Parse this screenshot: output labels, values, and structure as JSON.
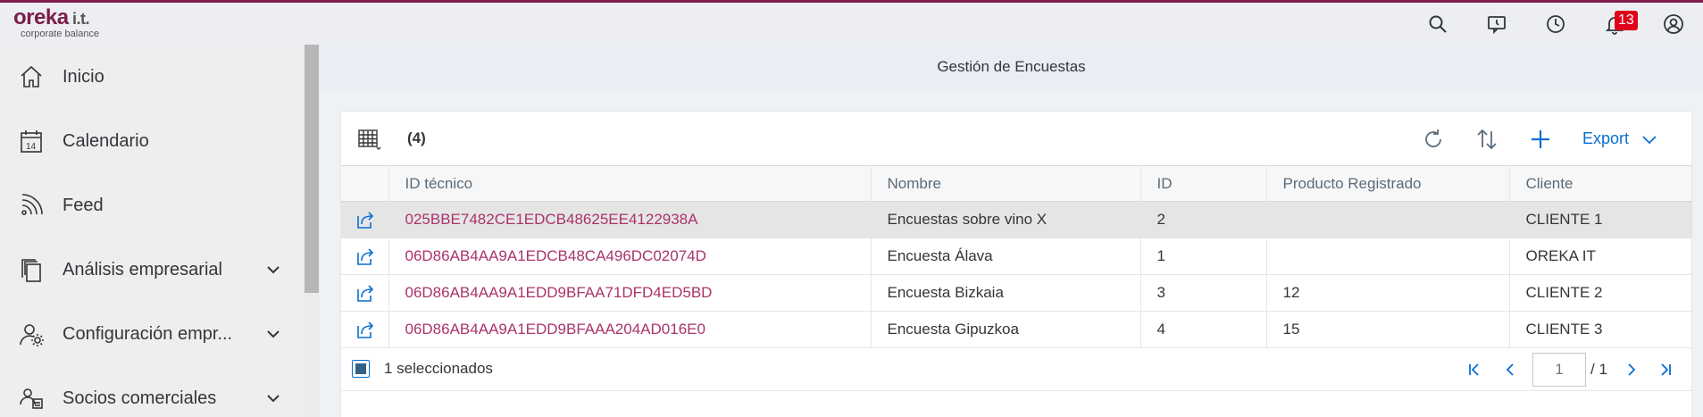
{
  "app": {
    "logo_main": "oreka",
    "logo_it": " i.t.",
    "logo_sub": "corporate balance",
    "notification_count": "13",
    "accent_color": "#7c1d4b"
  },
  "sidebar": {
    "items": [
      {
        "label": "Inicio",
        "icon": "home-icon",
        "expandable": false
      },
      {
        "label": "Calendario",
        "icon": "calendar-icon",
        "expandable": false
      },
      {
        "label": "Feed",
        "icon": "feed-icon",
        "expandable": false
      },
      {
        "label": "Análisis empresarial",
        "icon": "copy-icon",
        "expandable": true
      },
      {
        "label": "Configuración empr...",
        "icon": "settings-user-icon",
        "expandable": true
      },
      {
        "label": "Socios comerciales",
        "icon": "partners-icon",
        "expandable": true
      }
    ]
  },
  "page": {
    "title": "Gestión de Encuestas"
  },
  "toolbar": {
    "count": "(4)",
    "export_label": "Export"
  },
  "table": {
    "columns": [
      "ID técnico",
      "Nombre",
      "ID",
      "Producto Registrado",
      "Cliente"
    ],
    "rows": [
      {
        "tech_id": "025BBE7482CE1EDCB48625EE4122938A",
        "name": "Encuestas sobre vino X",
        "id": "2",
        "product": "",
        "client": "CLIENTE 1",
        "selected": true
      },
      {
        "tech_id": "06D86AB4AA9A1EDCB48CA496DC02074D",
        "name": "Encuesta Álava",
        "id": "1",
        "product": "",
        "client": "OREKA IT",
        "selected": false
      },
      {
        "tech_id": "06D86AB4AA9A1EDD9BFAA71DFD4ED5BD",
        "name": "Encuesta Bizkaia",
        "id": "3",
        "product": "12",
        "client": "CLIENTE 2",
        "selected": false
      },
      {
        "tech_id": "06D86AB4AA9A1EDD9BFAAA204AD016E0",
        "name": "Encuesta Gipuzkoa",
        "id": "4",
        "product": "15",
        "client": "CLIENTE 3",
        "selected": false
      }
    ]
  },
  "footer": {
    "selected_text": "1 seleccionados",
    "page_placeholder": "1",
    "page_total": "/ 1"
  }
}
